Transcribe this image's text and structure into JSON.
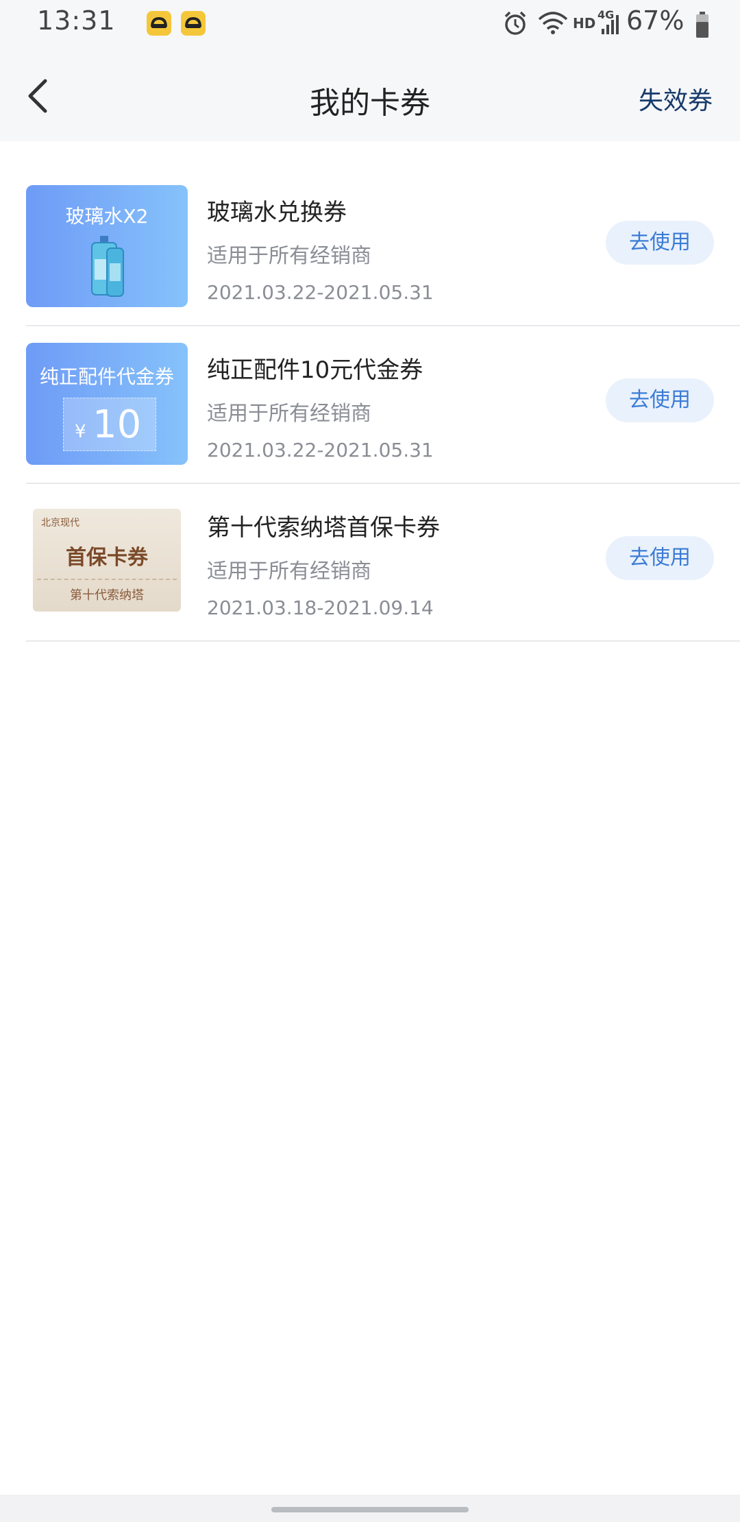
{
  "status_bar": {
    "time": "13:31",
    "network_hd": "HD",
    "network_type": "4G",
    "battery": "67%",
    "icons": [
      "app-notification-icon",
      "app-notification-icon",
      "alarm-icon",
      "wifi-icon",
      "signal-icon",
      "battery-icon"
    ]
  },
  "header": {
    "title": "我的卡券",
    "expired_link": "失效券",
    "back_icon": "chevron-left-icon"
  },
  "coupons": [
    {
      "thumb_title": "玻璃水X2",
      "name": "玻璃水兑换券",
      "scope": "适用于所有经销商",
      "date": "2021.03.22-2021.05.31",
      "action": "去使用"
    },
    {
      "thumb_title": "纯正配件代金券",
      "thumb_currency": "¥",
      "thumb_amount": "10",
      "name": "纯正配件10元代金券",
      "scope": "适用于所有经销商",
      "date": "2021.03.22-2021.05.31",
      "action": "去使用"
    },
    {
      "thumb_brand": "北京现代",
      "thumb_main": "首保卡券",
      "thumb_sub": "第十代索纳塔",
      "name": "第十代索纳塔首保卡券",
      "scope": "适用于所有经销商",
      "date": "2021.03.18-2021.09.14",
      "action": "去使用"
    }
  ],
  "colors": {
    "accent": "#3a7bd5",
    "button_bg": "#e9f1fc",
    "header_bg": "#f6f7f9",
    "expired_link": "#163a6b"
  }
}
